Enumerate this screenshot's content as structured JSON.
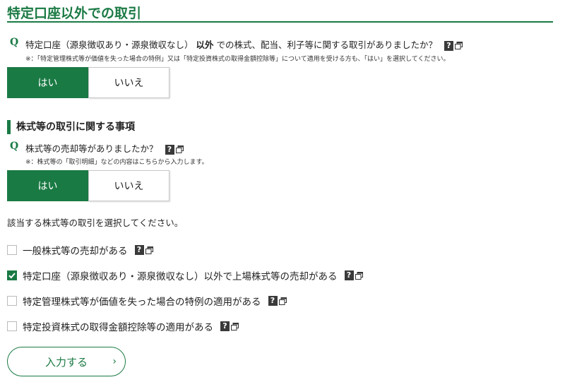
{
  "section": {
    "title": "特定口座以外での取引"
  },
  "q1": {
    "mark": "Q",
    "text_before": "特定口座（源泉徴収あり・源泉徴収なし）",
    "text_bold": "以外",
    "text_after": "での株式、配当、利子等に関する取引がありましたか？",
    "note": "※：「特定管理株式等が価値を失った場合の特例」又は「特定投資株式の取得金額控除等」について適用を受ける方も、「はい」を選択してください。",
    "yes_label": "はい",
    "no_label": "いいえ",
    "selected": "はい"
  },
  "sub_heading": "株式等の取引に関する事項",
  "q2": {
    "mark": "Q",
    "text": "株式等の売却等がありましたか？",
    "note": "※：株式等の「取引明細」などの内容はこちらから入力します。",
    "yes_label": "はい",
    "no_label": "いいえ",
    "selected": "はい"
  },
  "instruction": "該当する株式等の取引を選択してください。",
  "help_label": "?",
  "options": [
    {
      "label": "一般株式等の売却がある",
      "checked": false
    },
    {
      "label": "特定口座（源泉徴収あり・源泉徴収なし）以外で上場株式等の売却がある",
      "checked": true
    },
    {
      "label": "特定管理株式等が価値を失った場合の特例の適用がある",
      "checked": false
    },
    {
      "label": "特定投資株式の取得金額控除等の適用がある",
      "checked": false
    }
  ],
  "submit": {
    "label": "入力する",
    "arrow": "›"
  },
  "colors": {
    "accent": "#1a7a44",
    "help_bg": "#3a3a3a"
  }
}
